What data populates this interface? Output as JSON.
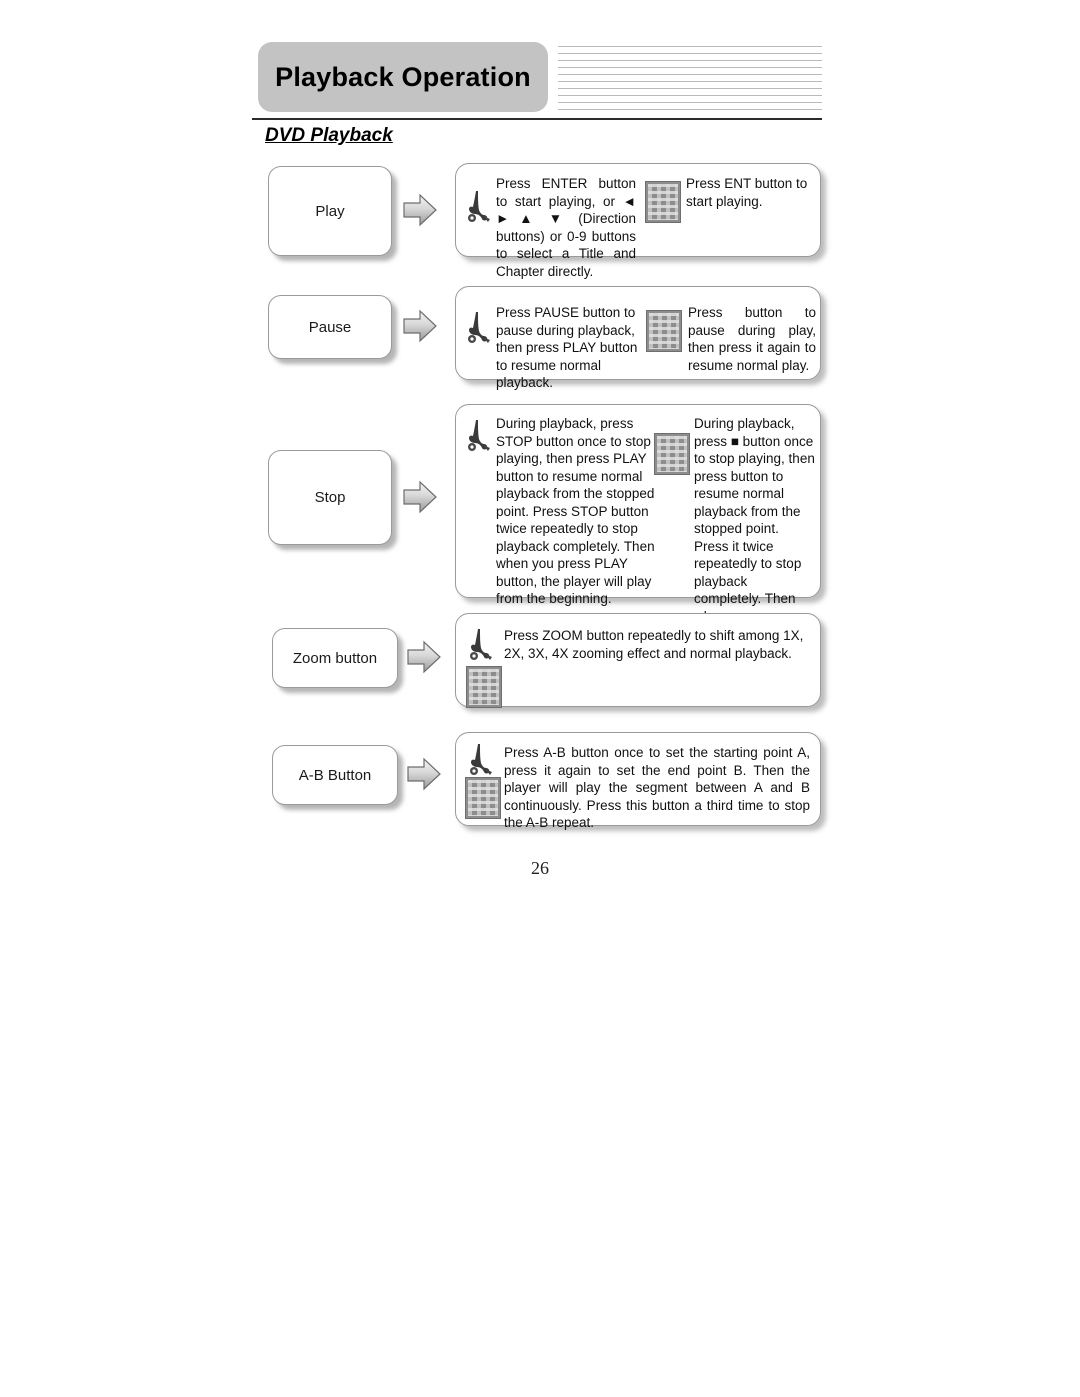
{
  "header": {
    "title": "Playback Operation",
    "section_heading": "DVD Playback",
    "stripes_count": 9,
    "title_box_color": "#c3c3c3"
  },
  "page_number": "26",
  "icons": {
    "hand": "hand-pointing-icon",
    "remote": "remote-control-thumbnail",
    "arrow": "right-block-arrow-icon"
  },
  "rows": [
    {
      "label": "Play",
      "columns": [
        {
          "id": "dvd-column",
          "text": "Press ENTER button to start playing, or ◄ ► ▲ ▼ (Direction buttons) or 0-9 buttons to select a Title and Chapter directly."
        },
        {
          "id": "remote-column",
          "text": "Press ENT button to start playing."
        }
      ]
    },
    {
      "label": "Pause",
      "columns": [
        {
          "id": "dvd-column",
          "text": "Press PAUSE button to pause during playback, then press PLAY button to resume normal playback."
        },
        {
          "id": "remote-column",
          "text": "Press      button to pause during play, then press it again to resume normal play."
        }
      ]
    },
    {
      "label": "Stop",
      "columns": [
        {
          "id": "dvd-column",
          "text": "During playback, press STOP button once to stop playing, then press PLAY button to resume normal playback from the stopped point. Press STOP button twice repeatedly to stop playback completely. Then when you press PLAY button, the player will play from the beginning."
        },
        {
          "id": "remote-column",
          "text": "During playback, press ■ button once to stop playing, then press      button to resume normal playback from the stopped point. Press it twice repeatedly to stop playback completely. Then when you press button, the player will play from the beginning."
        }
      ]
    },
    {
      "label": "Zoom button",
      "columns": [
        {
          "id": "single-column",
          "text": "Press ZOOM button repeatedly to shift among 1X, 2X, 3X, 4X zooming effect and normal playback."
        }
      ]
    },
    {
      "label": "A-B Button",
      "columns": [
        {
          "id": "single-column",
          "text": "Press A-B button once to set the starting point A, press it again to set the end point B. Then the player will play the segment between A and B continuously. Press this button a third time to stop the A-B repeat."
        }
      ]
    }
  ]
}
